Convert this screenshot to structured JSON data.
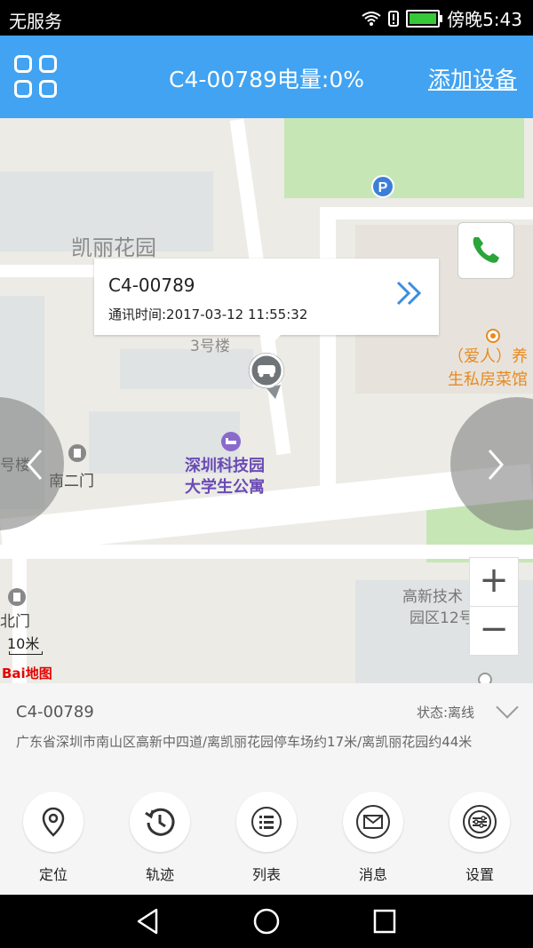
{
  "status_bar": {
    "carrier": "无服务",
    "time": "傍晚5:43"
  },
  "header": {
    "device_title": "C4-00789电量:0%",
    "add_device": "添加设备"
  },
  "map": {
    "labels": {
      "kaili_garden": "凯丽花园",
      "building3": "3号楼",
      "building_left": "号楼",
      "south_gate": "南二门",
      "north_gate": "北门",
      "poi_orange_1": "（爱人）养",
      "poi_orange_2": "生私房菜馆",
      "poi_purple_1": "深圳科技园",
      "poi_purple_2": "大学生公寓",
      "gaoxin_1": "高新技术",
      "gaoxin_2": "园区12号"
    },
    "popup": {
      "device": "C4-00789",
      "comm_time": "通讯时间:2017-03-12 11:55:32"
    },
    "scale": "10米",
    "logo": "Bai地图"
  },
  "info": {
    "device": "C4-00789",
    "status": "状态:离线",
    "address": "广东省深圳市南山区高新中四道/离凯丽花园停车场约17米/离凯丽花园约44米"
  },
  "toolbar": [
    {
      "label": "定位",
      "icon": "location-pin-icon"
    },
    {
      "label": "轨迹",
      "icon": "history-icon"
    },
    {
      "label": "列表",
      "icon": "list-icon"
    },
    {
      "label": "消息",
      "icon": "mail-icon"
    },
    {
      "label": "设置",
      "icon": "settings-icon"
    }
  ],
  "colors": {
    "header": "#41a3f1",
    "accent_blue": "#3a8de0",
    "call_green": "#2aa53a"
  }
}
